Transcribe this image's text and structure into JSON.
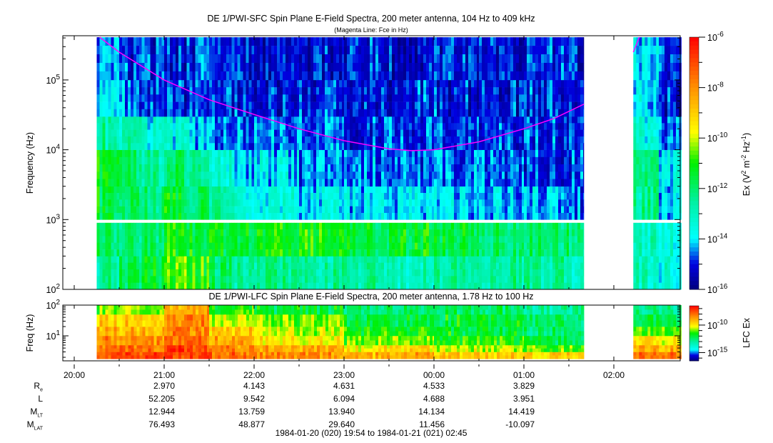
{
  "chart_data": [
    {
      "type": "heatmap",
      "title": "DE 1/PWI-SFC  Spin Plane E-Field Spectra, 200 meter antenna, 104 Hz to 409 kHz",
      "subtitle": "(Magenta Line: Fce in Hz)",
      "ylabel": "Frequency (Hz)",
      "yscale": "log",
      "ylim": [
        100,
        409000
      ],
      "yticks": [
        "10^2",
        "10^3",
        "10^4",
        "10^5"
      ],
      "colorbar": {
        "label": "Ex (V^2 m^-2 Hz^-1)",
        "range_log10": [
          -16,
          -6
        ],
        "ticks": [
          "10^-6",
          "10^-8",
          "10^-10",
          "10^-12",
          "10^-14",
          "10^-16"
        ]
      },
      "freq_bands_hz": [
        [
          100,
          300
        ],
        [
          300,
          900
        ],
        [
          1000,
          3000
        ],
        [
          3000,
          10000
        ],
        [
          10000,
          30000
        ],
        [
          30000,
          100000
        ],
        [
          100000,
          409000
        ]
      ],
      "time_bins": [
        {
          "start": "20:15",
          "end": "20:30",
          "log10_ex": [
            -12.5,
            -12,
            -11.5,
            -11.5,
            -12.5,
            -14,
            -14.5
          ]
        },
        {
          "start": "20:30",
          "end": "20:45",
          "log10_ex": [
            -12,
            -12,
            -12,
            -12,
            -13,
            -14.5,
            -15
          ]
        },
        {
          "start": "20:45",
          "end": "21:00",
          "log10_ex": [
            -11.5,
            -12,
            -12,
            -12.5,
            -13.5,
            -15,
            -15
          ]
        },
        {
          "start": "21:00",
          "end": "21:15",
          "log10_ex": [
            -10.5,
            -11,
            -11.5,
            -12,
            -13.5,
            -15,
            -15
          ]
        },
        {
          "start": "21:15",
          "end": "21:30",
          "log10_ex": [
            -11,
            -11.5,
            -12,
            -12.5,
            -14,
            -15,
            -15
          ]
        },
        {
          "start": "21:30",
          "end": "21:45",
          "log10_ex": [
            -12,
            -11.5,
            -12.5,
            -13.5,
            -14.5,
            -15,
            -15
          ]
        },
        {
          "start": "21:45",
          "end": "22:00",
          "log10_ex": [
            -12.5,
            -11.5,
            -13.5,
            -14,
            -14.5,
            -15,
            -15
          ]
        },
        {
          "start": "22:00",
          "end": "22:30",
          "log10_ex": [
            -12.5,
            -11,
            -13.5,
            -14,
            -14.5,
            -15,
            -15.2
          ]
        },
        {
          "start": "22:30",
          "end": "23:00",
          "log10_ex": [
            -12.5,
            -11,
            -14,
            -14.5,
            -14.8,
            -15,
            -15.2
          ]
        },
        {
          "start": "23:00",
          "end": "23:30",
          "log10_ex": [
            -12.5,
            -11.5,
            -14,
            -14.5,
            -14.8,
            -15,
            -15.2
          ]
        },
        {
          "start": "23:30",
          "end": "00:00",
          "log10_ex": [
            -13,
            -11.5,
            -14,
            -14.6,
            -14.8,
            -15,
            -15.2
          ]
        },
        {
          "start": "00:00",
          "end": "00:30",
          "log10_ex": [
            -12.5,
            -11.5,
            -14.2,
            -14.6,
            -14.8,
            -15,
            -15
          ]
        },
        {
          "start": "00:30",
          "end": "01:00",
          "log10_ex": [
            -12.5,
            -12,
            -14.2,
            -14.6,
            -14.8,
            -15,
            -15
          ]
        },
        {
          "start": "01:00",
          "end": "01:30",
          "log10_ex": [
            -12.5,
            -12,
            -14.2,
            -14.8,
            -14.8,
            -15,
            -15
          ]
        },
        {
          "start": "01:30",
          "end": "01:40",
          "log10_ex": [
            -13,
            -12,
            -14.5,
            -14.8,
            -15,
            -15,
            -15
          ]
        },
        {
          "start": "02:13",
          "end": "02:30",
          "log10_ex": [
            -13,
            -13,
            -12.5,
            -12.5,
            -13.5,
            -14,
            -14
          ]
        },
        {
          "start": "02:30",
          "end": "02:45",
          "log10_ex": [
            -13.5,
            -13.5,
            -14,
            -14,
            -14.5,
            -15,
            -15
          ]
        }
      ],
      "fce_line": [
        [
          "20:17",
          409000
        ],
        [
          "20:30",
          250000
        ],
        [
          "21:00",
          100000
        ],
        [
          "21:30",
          52000
        ],
        [
          "22:00",
          32000
        ],
        [
          "22:30",
          20000
        ],
        [
          "23:00",
          13500
        ],
        [
          "23:30",
          10300
        ],
        [
          "23:45",
          9700
        ],
        [
          "00:00",
          10000
        ],
        [
          "00:30",
          13000
        ],
        [
          "01:00",
          20000
        ],
        [
          "01:20",
          28000
        ],
        [
          "01:40",
          45000
        ],
        null,
        [
          "02:13",
          250000
        ],
        [
          "02:17",
          409000
        ]
      ],
      "fce_color": "#ff00ff"
    },
    {
      "type": "heatmap",
      "title": "DE 1/PWI-LFC  Spin Plane E-Field Spectra, 200 meter antenna, 1.78 Hz to 100 Hz",
      "ylabel": "Freq (Hz)",
      "yscale": "log",
      "ylim": [
        1.78,
        100
      ],
      "yticks": [
        "10^2",
        "10^1"
      ],
      "colorbar": {
        "label": "LFC Ex",
        "range_log10": [
          -16.5,
          -6.5
        ],
        "ticks": [
          "10^-10",
          "10^-15"
        ]
      },
      "freq_bands_hz": [
        [
          1.78,
          3
        ],
        [
          3,
          5
        ],
        [
          5,
          10
        ],
        [
          10,
          20
        ],
        [
          20,
          50
        ],
        [
          50,
          100
        ]
      ],
      "time_bins": [
        {
          "start": "20:15",
          "end": "21:00",
          "log10_ex": [
            -7.5,
            -8,
            -8.5,
            -9,
            -9.5,
            -11
          ]
        },
        {
          "start": "21:00",
          "end": "21:30",
          "log10_ex": [
            -7.3,
            -7.5,
            -8,
            -8.3,
            -8.5,
            -9
          ]
        },
        {
          "start": "21:30",
          "end": "22:00",
          "log10_ex": [
            -8,
            -8.5,
            -9,
            -9.5,
            -10.5,
            -11.5
          ]
        },
        {
          "start": "22:00",
          "end": "23:00",
          "log10_ex": [
            -8.5,
            -9,
            -10,
            -10.5,
            -11,
            -12
          ]
        },
        {
          "start": "23:00",
          "end": "00:00",
          "log10_ex": [
            -9,
            -10,
            -11,
            -11.5,
            -12,
            -12.5
          ]
        },
        {
          "start": "00:00",
          "end": "01:00",
          "log10_ex": [
            -9.5,
            -10.5,
            -11.5,
            -12,
            -12,
            -12.5
          ]
        },
        {
          "start": "01:00",
          "end": "01:40",
          "log10_ex": [
            -9.5,
            -11,
            -12,
            -12.5,
            -12.5,
            -13
          ]
        },
        {
          "start": "02:13",
          "end": "02:45",
          "log10_ex": [
            -8,
            -9,
            -10,
            -11,
            -12,
            -13
          ]
        }
      ]
    }
  ],
  "xaxis": {
    "ticks": [
      "20:00",
      "21:00",
      "22:00",
      "23:00",
      "00:00",
      "01:00",
      "02:00"
    ]
  },
  "ephemeris": {
    "rows": [
      {
        "label": "R",
        "sub": "e",
        "values": [
          "2.970",
          "4.143",
          "4.631",
          "4.533",
          "3.829"
        ]
      },
      {
        "label": "L",
        "sub": "",
        "values": [
          "52.205",
          "9.542",
          "6.094",
          "4.688",
          "3.951"
        ]
      },
      {
        "label": "M",
        "sub": "LT",
        "values": [
          "12.944",
          "13.759",
          "13.940",
          "14.134",
          "14.419"
        ]
      },
      {
        "label": "M",
        "sub": "LAT",
        "values": [
          "76.493",
          "48.877",
          "29.640",
          "11.456",
          "-10.097"
        ]
      }
    ],
    "time_range": "1984-01-20 (020) 19:54 to 1984-01-21 (021) 02:45"
  }
}
